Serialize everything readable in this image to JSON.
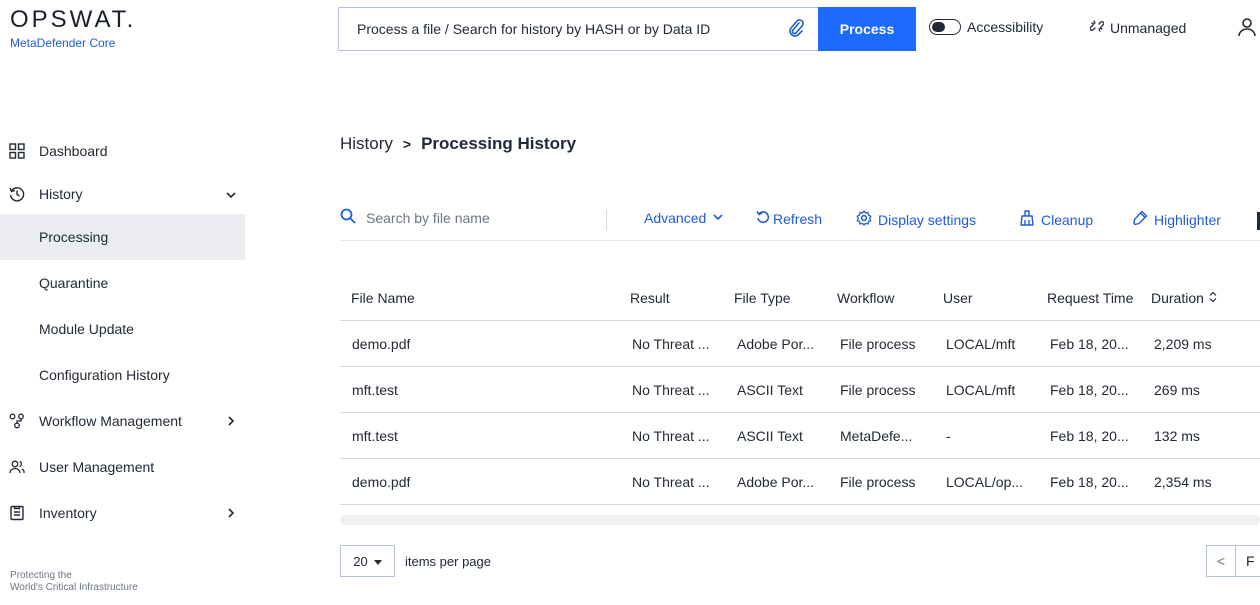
{
  "app": {
    "logo_text": "OPSWAT.",
    "product_name": "MetaDefender Core",
    "tagline_line1": "Protecting the",
    "tagline_line2": "World's Critical Infrastructure"
  },
  "topbar": {
    "search_placeholder": "Process a file / Search for history by HASH or by Data ID",
    "process_label": "Process",
    "accessibility_label": "Accessibility",
    "unmanaged_label": "Unmanaged"
  },
  "sidebar": {
    "items": [
      {
        "label": "Dashboard",
        "icon": "dashboard-icon"
      },
      {
        "label": "History",
        "icon": "history-icon",
        "expanded": true
      },
      {
        "label": "Processing",
        "active": true
      },
      {
        "label": "Quarantine"
      },
      {
        "label": "Module Update"
      },
      {
        "label": "Configuration History"
      },
      {
        "label": "Workflow Management",
        "icon": "workflow-icon"
      },
      {
        "label": "User Management",
        "icon": "users-icon"
      },
      {
        "label": "Inventory",
        "icon": "inventory-icon"
      }
    ]
  },
  "breadcrumb": {
    "parent": "History",
    "separator": ">",
    "current": "Processing History"
  },
  "toolbar": {
    "search_placeholder": "Search by file name",
    "advanced": "Advanced",
    "refresh": "Refresh",
    "display_settings": "Display settings",
    "cleanup": "Cleanup",
    "highlighter": "Highlighter"
  },
  "table": {
    "columns": [
      "File Name",
      "Result",
      "File Type",
      "Workflow",
      "User",
      "Request Time",
      "Duration"
    ],
    "rows": [
      {
        "file_name": "demo.pdf",
        "result": "No Threat ...",
        "file_type": "Adobe Por...",
        "workflow": "File process",
        "user": "LOCAL/mft",
        "request_time": "Feb 18, 20...",
        "duration": "2,209 ms"
      },
      {
        "file_name": "mft.test",
        "result": "No Threat ...",
        "file_type": "ASCII Text",
        "workflow": "File process",
        "user": "LOCAL/mft",
        "request_time": "Feb 18, 20...",
        "duration": "269 ms"
      },
      {
        "file_name": "mft.test",
        "result": "No Threat ...",
        "file_type": "ASCII Text",
        "workflow": "MetaDefe...",
        "user": "-",
        "request_time": "Feb 18, 20...",
        "duration": "132 ms"
      },
      {
        "file_name": "demo.pdf",
        "result": "No Threat ...",
        "file_type": "Adobe Por...",
        "workflow": "File process",
        "user": "LOCAL/op...",
        "request_time": "Feb 18, 20...",
        "duration": "2,354 ms"
      }
    ]
  },
  "pagination": {
    "page_size": "20",
    "items_per_page_label": "items per page",
    "prev": "<",
    "next_partial": "F"
  },
  "colors": {
    "accent": "#1d6bfc",
    "link": "#1f5bd8",
    "active_bg": "#ebedf1"
  }
}
